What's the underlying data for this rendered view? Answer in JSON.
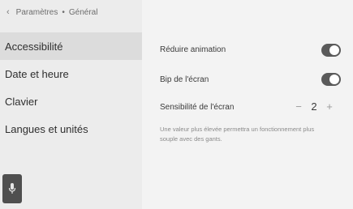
{
  "breadcrumb": {
    "parent": "Paramètres",
    "separator": "•",
    "current": "Général"
  },
  "sidebar": {
    "items": [
      {
        "label": "Accessibilité",
        "selected": true
      },
      {
        "label": "Date et heure",
        "selected": false
      },
      {
        "label": "Clavier",
        "selected": false
      },
      {
        "label": "Langues et unités",
        "selected": false
      }
    ]
  },
  "settings": {
    "reduce_animation": {
      "label": "Réduire animation",
      "state": "on"
    },
    "screen_beep": {
      "label": "Bip de l'écran",
      "state": "on"
    },
    "sensitivity": {
      "label": "Sensibilité de l'écran",
      "minus": "−",
      "value": "2",
      "plus": "+",
      "description": "Une valeur plus élevée permettra un fonctionnement plus souple avec des gants."
    }
  },
  "icons": {
    "back": "chevron-left-icon",
    "voice": "microphone-icon"
  }
}
